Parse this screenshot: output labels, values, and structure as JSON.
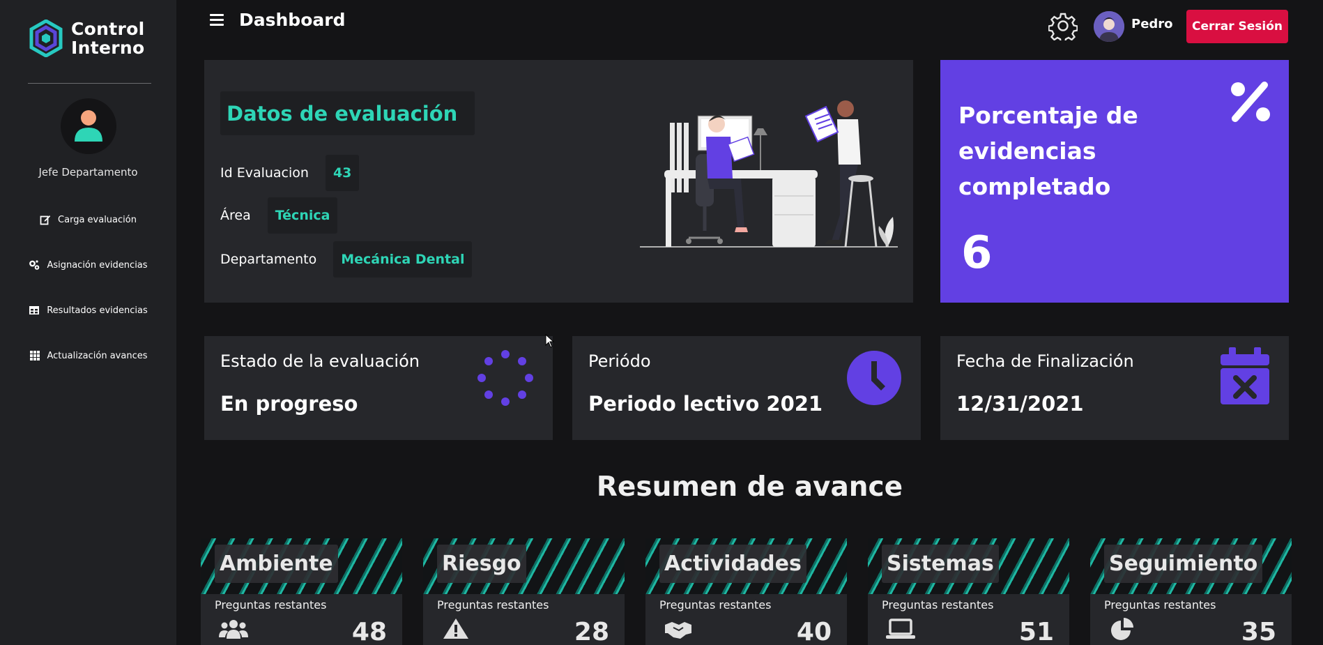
{
  "sidebar": {
    "logo_text_line1": "Control",
    "logo_text_line2": "Interno",
    "role": "Jefe Departamento",
    "items": [
      {
        "label": "Carga evaluación",
        "icon": "edit-icon"
      },
      {
        "label": "Asignación evidencias",
        "icon": "cogs-icon"
      },
      {
        "label": "Resultados evidencias",
        "icon": "table-icon"
      },
      {
        "label": "Actualización avances",
        "icon": "grid-icon"
      }
    ]
  },
  "header": {
    "title": "Dashboard",
    "user_name": "Pedro",
    "logout_label": "Cerrar Sesión"
  },
  "evaluation": {
    "title": "Datos de evaluación",
    "id_label": "Id Evaluacion",
    "id_value": "43",
    "area_label": "Área",
    "area_value": "Técnica",
    "department_label": "Departamento",
    "department_value": "Mecánica Dental"
  },
  "percentage": {
    "title": "Porcentaje de evidencias completado",
    "value": "6"
  },
  "status": {
    "label": "Estado de la evaluación",
    "value": "En progreso"
  },
  "period": {
    "label": "Periódo",
    "value": "Periodo lectivo 2021"
  },
  "end_date": {
    "label": "Fecha de Finalización",
    "value": "12/31/2021"
  },
  "summary": {
    "title": "Resumen de avance",
    "subtitle": "Preguntas restantes",
    "cards": [
      {
        "name": "Ambiente",
        "count": "48",
        "icon": "users-icon"
      },
      {
        "name": "Riesgo",
        "count": "28",
        "icon": "warning-icon"
      },
      {
        "name": "Actividades",
        "count": "40",
        "icon": "handshake-icon"
      },
      {
        "name": "Sistemas",
        "count": "51",
        "icon": "laptop-icon"
      },
      {
        "name": "Seguimiento",
        "count": "35",
        "icon": "pie-chart-icon"
      }
    ]
  },
  "colors": {
    "accent_teal": "#2ed5b6",
    "accent_purple": "#6240e3",
    "danger": "#d90f41",
    "sidebar_bg": "#202124",
    "card_bg": "#26272b"
  }
}
